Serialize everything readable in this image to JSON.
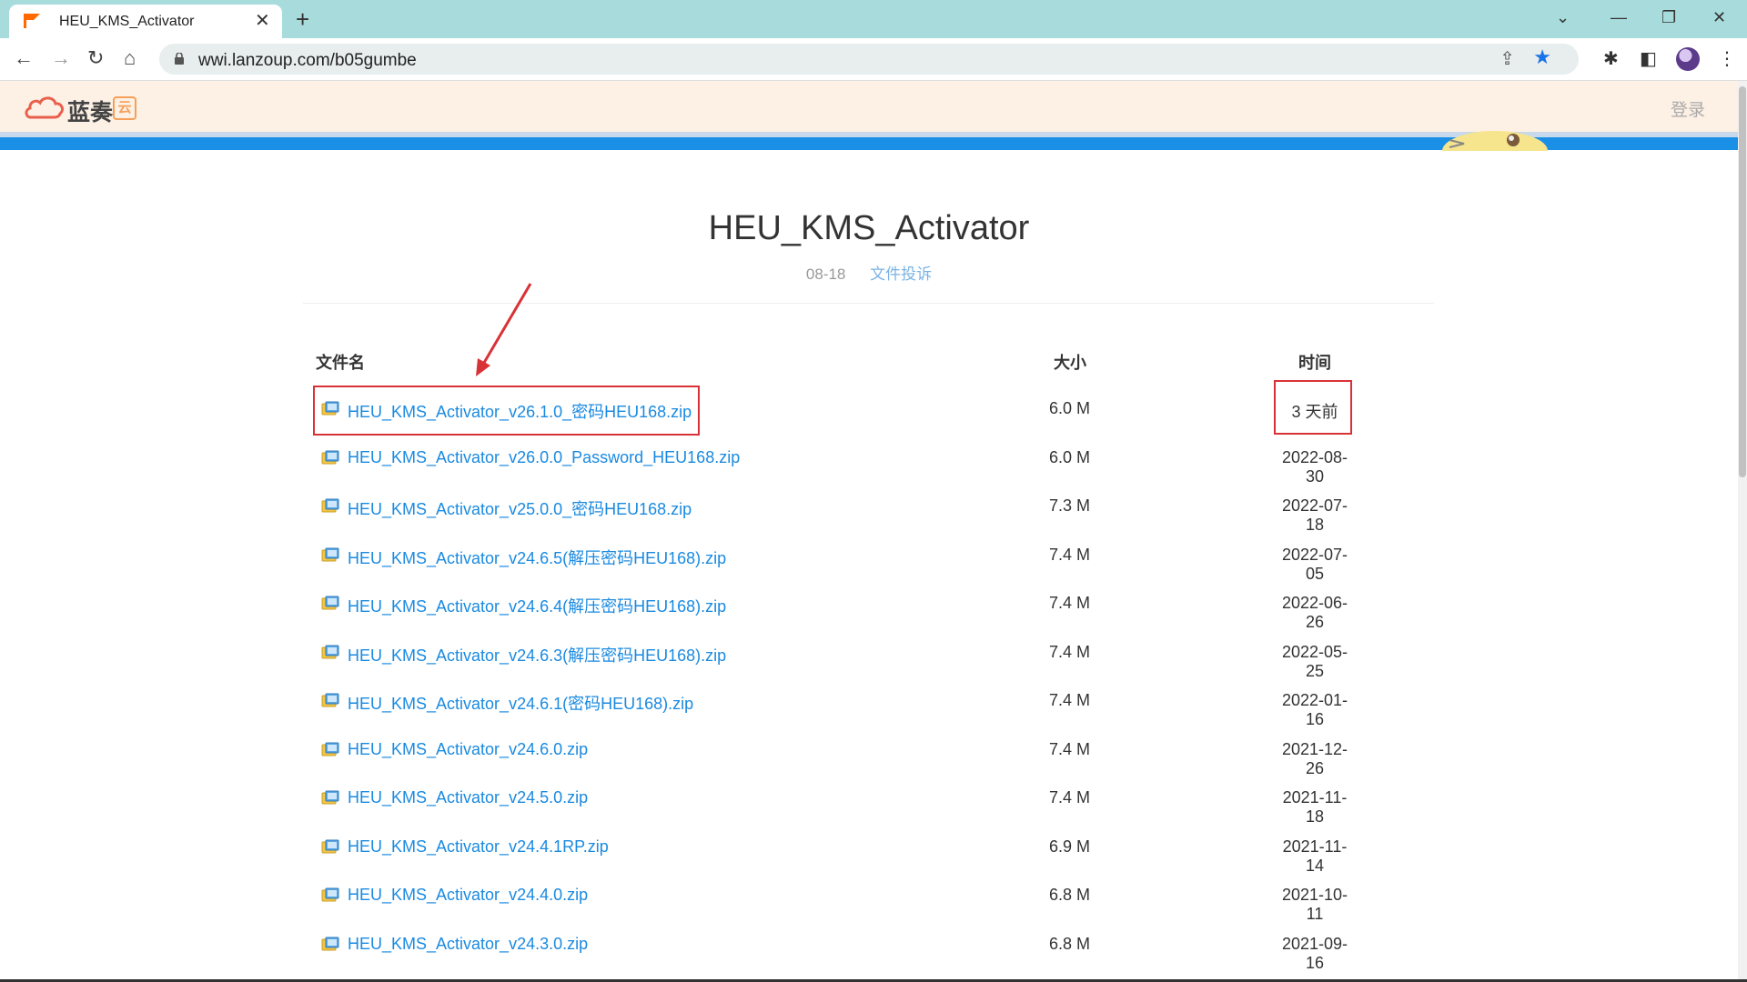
{
  "browser": {
    "tab_title": "HEU_KMS_Activator",
    "url": "wwi.lanzoup.com/b05gumbe"
  },
  "site": {
    "logo_text": "蓝奏",
    "logo_badge": "云",
    "login_label": "登录"
  },
  "file": {
    "title": "HEU_KMS_Activator",
    "date": "08-18",
    "report_label": "文件投诉"
  },
  "table": {
    "headers": {
      "name": "文件名",
      "size": "大小",
      "time": "时间"
    },
    "rows": [
      {
        "name": "HEU_KMS_Activator_v26.1.0_密码HEU168.zip",
        "size": "6.0 M",
        "time": "3 天前"
      },
      {
        "name": "HEU_KMS_Activator_v26.0.0_Password_HEU168.zip",
        "size": "6.0 M",
        "time": "2022-08-30"
      },
      {
        "name": "HEU_KMS_Activator_v25.0.0_密码HEU168.zip",
        "size": "7.3 M",
        "time": "2022-07-18"
      },
      {
        "name": "HEU_KMS_Activator_v24.6.5(解压密码HEU168).zip",
        "size": "7.4 M",
        "time": "2022-07-05"
      },
      {
        "name": "HEU_KMS_Activator_v24.6.4(解压密码HEU168).zip",
        "size": "7.4 M",
        "time": "2022-06-26"
      },
      {
        "name": "HEU_KMS_Activator_v24.6.3(解压密码HEU168).zip",
        "size": "7.4 M",
        "time": "2022-05-25"
      },
      {
        "name": "HEU_KMS_Activator_v24.6.1(密码HEU168).zip",
        "size": "7.4 M",
        "time": "2022-01-16"
      },
      {
        "name": "HEU_KMS_Activator_v24.6.0.zip",
        "size": "7.4 M",
        "time": "2021-12-26"
      },
      {
        "name": "HEU_KMS_Activator_v24.5.0.zip",
        "size": "7.4 M",
        "time": "2021-11-18"
      },
      {
        "name": "HEU_KMS_Activator_v24.4.1RP.zip",
        "size": "6.9 M",
        "time": "2021-11-14"
      },
      {
        "name": "HEU_KMS_Activator_v24.4.0.zip",
        "size": "6.8 M",
        "time": "2021-10-11"
      },
      {
        "name": "HEU_KMS_Activator_v24.3.0.zip",
        "size": "6.8 M",
        "time": "2021-09-16"
      }
    ]
  },
  "colors": {
    "link": "#1a8ae0",
    "accent_bar": "#1a8fe6",
    "highlight": "#d93236"
  }
}
